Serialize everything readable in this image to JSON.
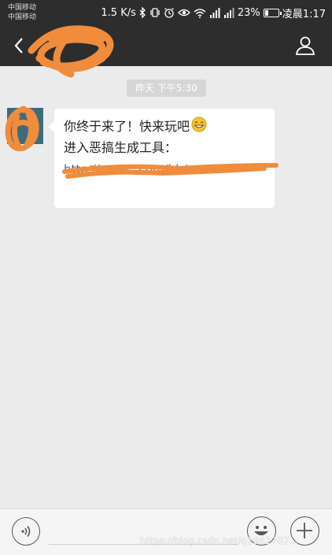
{
  "status_bar": {
    "carrier_1": "中国移动",
    "carrier_2": "中国移动",
    "speed": "1.5 K/s",
    "battery": "23%",
    "battery_level": 0.23,
    "time": "凌晨1:17",
    "icons": [
      "bluetooth-icon",
      "vibrate-icon",
      "alarm-icon",
      "eye-icon",
      "wifi-icon",
      "signal-icon",
      "signal-icon",
      "battery-icon"
    ]
  },
  "header": {
    "title": "",
    "icons": [
      "back-arrow-icon",
      "profile-icon"
    ]
  },
  "chat": {
    "timestamp": "昨天 下午5:30",
    "message": {
      "line1": "你终于来了！快来玩吧",
      "line2": "进入恶搞生成工具：",
      "link": "http://www.               .com/bb/"
    }
  },
  "input_bar": {
    "icons": [
      "voice-icon",
      "emoji-icon",
      "plus-icon"
    ]
  },
  "watermark": "https://blog.csdn.net/q1962702...",
  "colors": {
    "header_bg": "#2d2d2d",
    "chat_bg": "#ebebeb",
    "bubble_bg": "#ffffff",
    "link": "#3f6db0",
    "scribble": "#f08c3c"
  }
}
